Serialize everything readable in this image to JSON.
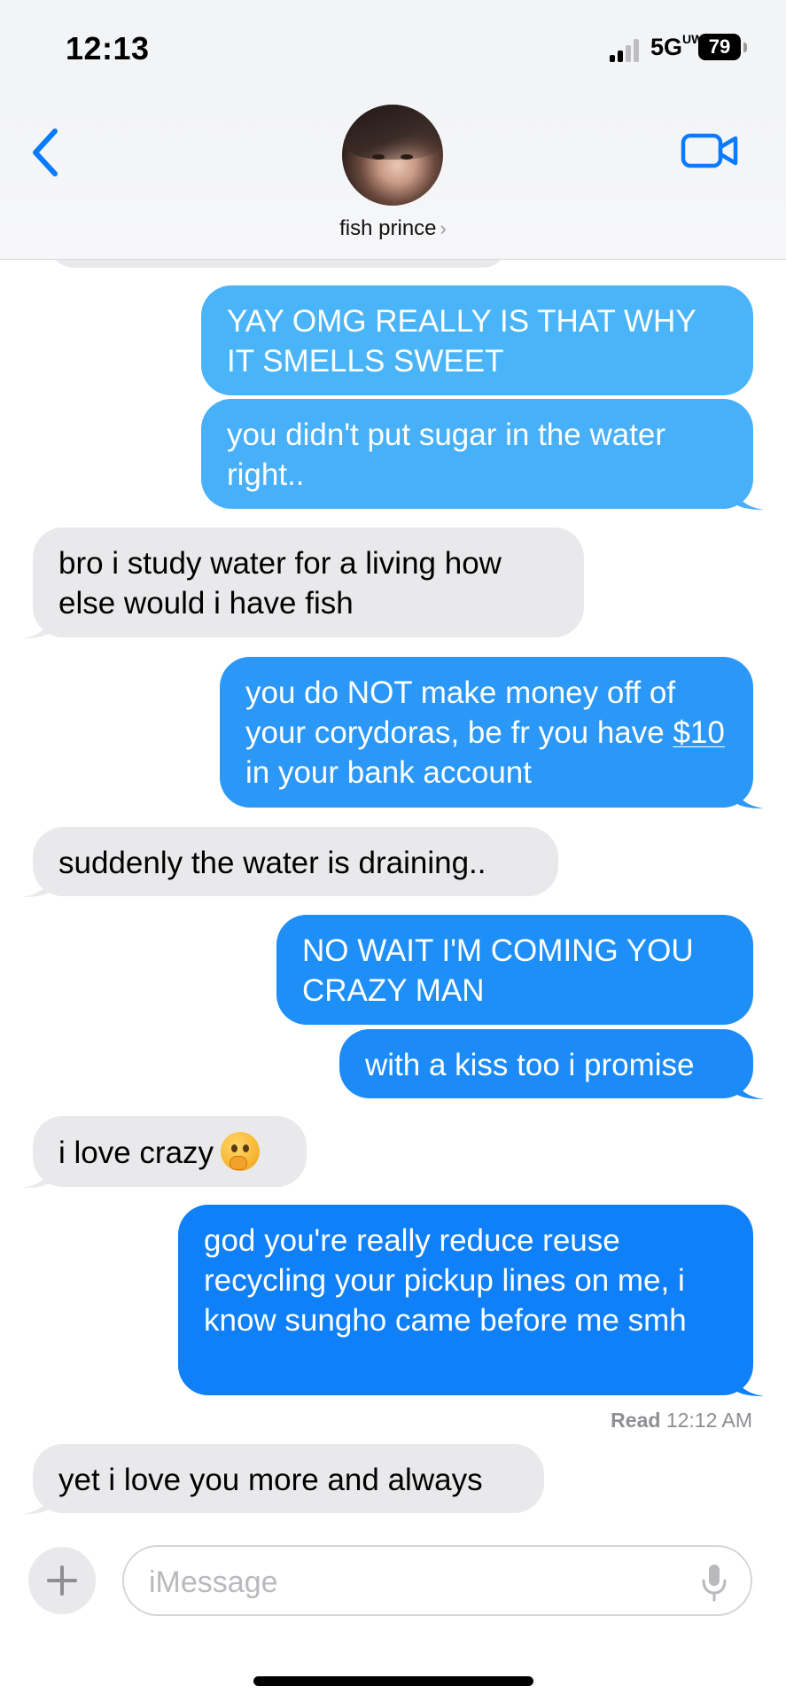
{
  "status_bar": {
    "time": "12:13",
    "network": "5G",
    "network_suffix": "UW",
    "battery": "79"
  },
  "header": {
    "contact_name": "fish prince",
    "chevron": "›",
    "back_icon": "chevron-left-icon",
    "video_icon": "video-camera-icon",
    "accent_color": "#0a7aff"
  },
  "messages": [
    {
      "direction": "out",
      "text": "YAY OMG REALLY IS THAT WHY IT SMELLS SWEET"
    },
    {
      "direction": "out",
      "text": "you didn't put sugar in the water right.."
    },
    {
      "direction": "in",
      "text": "bro i study water for a living how else would i have fish"
    },
    {
      "direction": "out",
      "text_before": "you do NOT make money off of your corydoras, be fr you have ",
      "link": "$10",
      "text_after": " in your bank account"
    },
    {
      "direction": "in",
      "text": "suddenly the water is draining.."
    },
    {
      "direction": "out",
      "text": "NO WAIT I'M COMING YOU CRAZY MAN"
    },
    {
      "direction": "out",
      "text": "with a kiss too i promise"
    },
    {
      "direction": "in",
      "text": "i love crazy",
      "emoji": "thinking-face-emoji"
    },
    {
      "direction": "out",
      "text": "god you're really reduce reuse recycling your pickup lines on me, i know sungho came before me smh"
    },
    {
      "direction": "in",
      "text": "yet i love you more and always"
    }
  ],
  "read_receipt": {
    "label": "Read",
    "time": "12:12 AM"
  },
  "composer": {
    "placeholder": "iMessage",
    "plus_icon": "plus-icon",
    "mic_icon": "microphone-icon"
  },
  "colors": {
    "bubble_out_top": "#4ab3f8",
    "bubble_out_bottom": "#0a7aff",
    "bubble_in": "#e9e9eb"
  }
}
